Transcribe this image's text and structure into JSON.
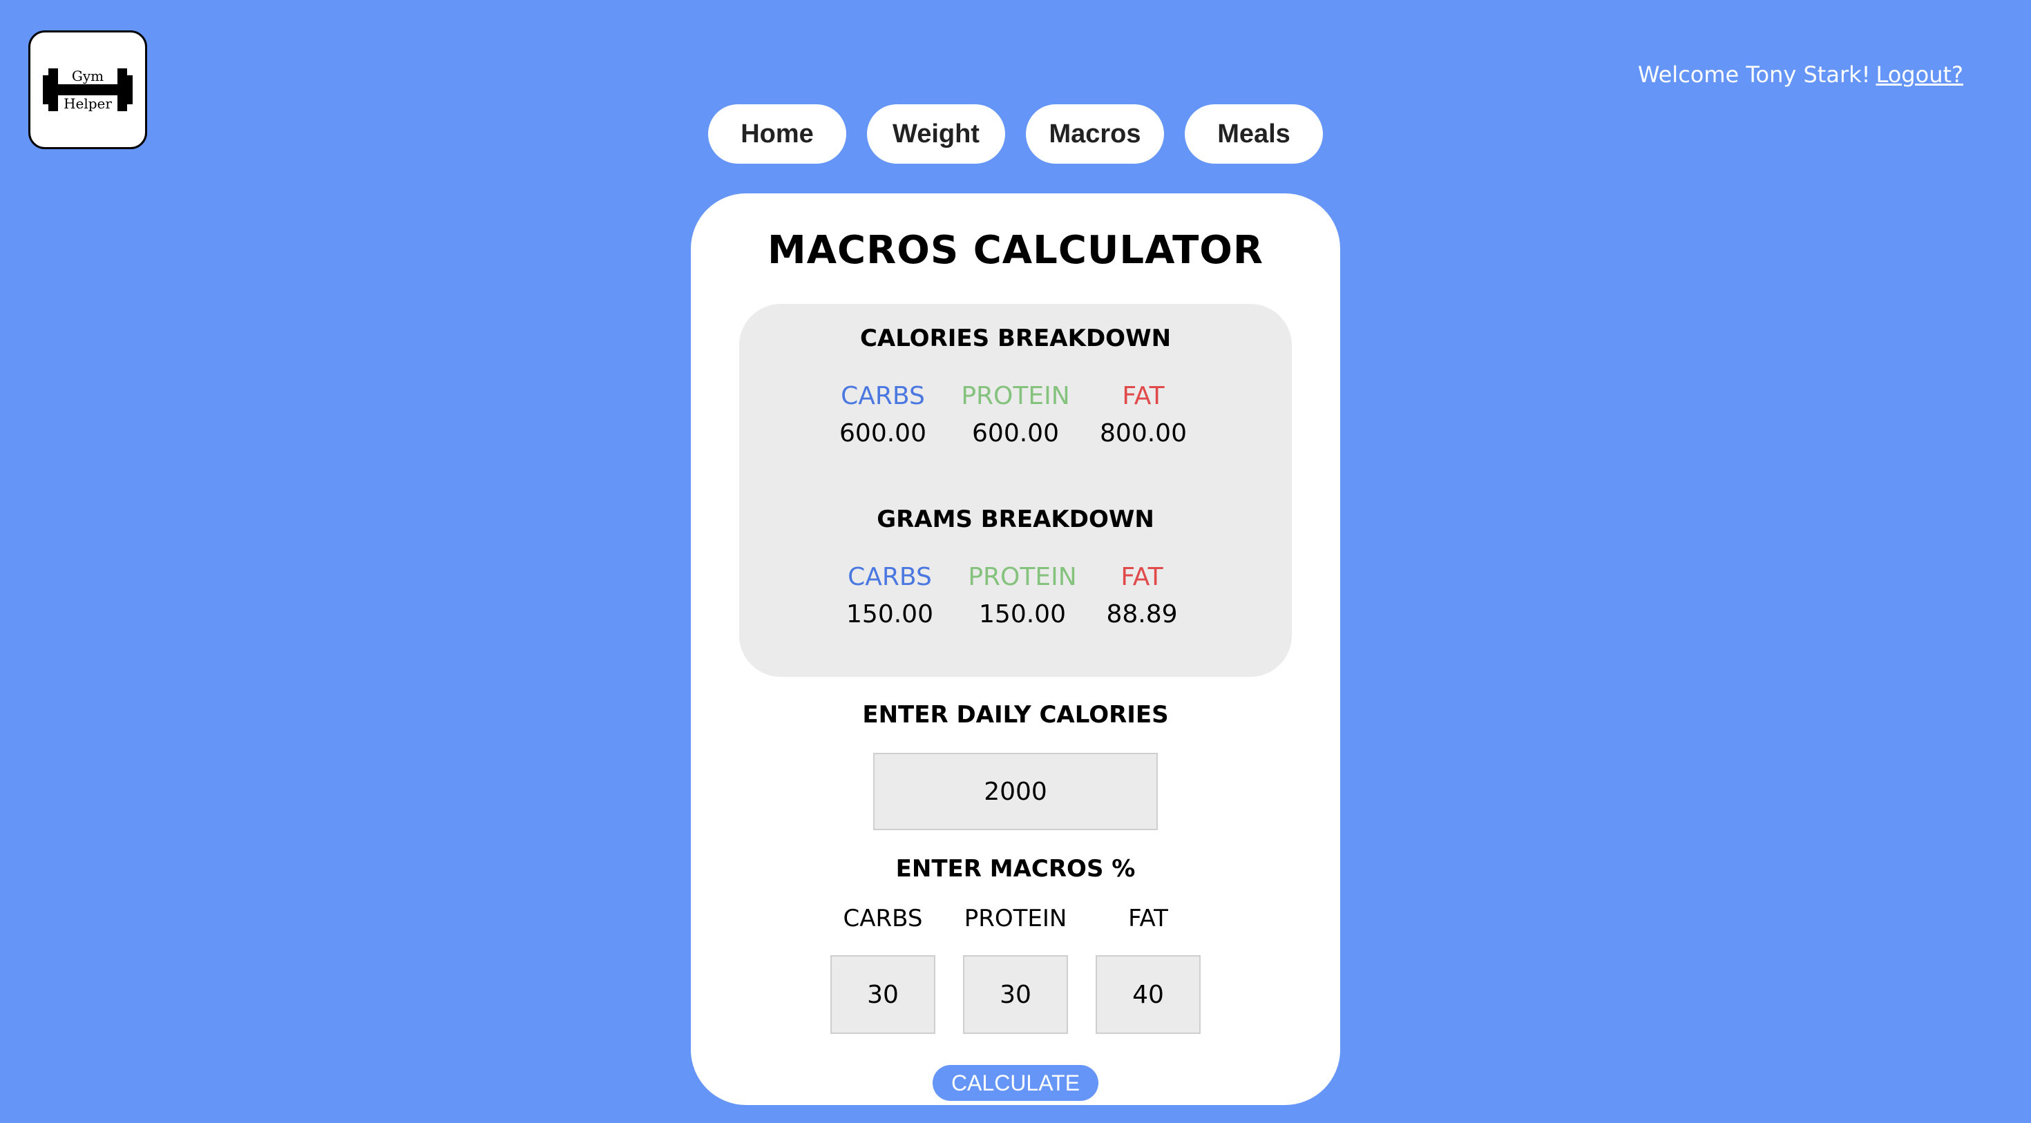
{
  "logo": {
    "line1": "Gym",
    "line2": "Helper",
    "icon": "dumbbell-icon"
  },
  "header": {
    "welcome_text": "Welcome Tony Stark!",
    "logout_label": "Logout?"
  },
  "nav": {
    "items": [
      {
        "label": "Home"
      },
      {
        "label": "Weight"
      },
      {
        "label": "Macros"
      },
      {
        "label": "Meals"
      }
    ]
  },
  "main": {
    "title": "MACROS CALCULATOR",
    "calories_breakdown": {
      "heading": "CALORIES BREAKDOWN",
      "carbs_label": "CARBS",
      "protein_label": "PROTEIN",
      "fat_label": "FAT",
      "carbs": "600.00",
      "protein": "600.00",
      "fat": "800.00"
    },
    "grams_breakdown": {
      "heading": "GRAMS BREAKDOWN",
      "carbs_label": "CARBS",
      "protein_label": "PROTEIN",
      "fat_label": "FAT",
      "carbs": "150.00",
      "protein": "150.00",
      "fat": "88.89"
    },
    "daily": {
      "heading": "ENTER DAILY CALORIES",
      "value": "2000"
    },
    "macros_pct": {
      "heading": "ENTER MACROS %",
      "carbs_label": "CARBS",
      "protein_label": "PROTEIN",
      "fat_label": "FAT",
      "carbs": "30",
      "protein": "30",
      "fat": "40"
    },
    "calculate_label": "CALCULATE"
  },
  "colors": {
    "background": "#6495f7",
    "carbs": "#4a78e0",
    "protein": "#84c27d",
    "fat": "#e04a4a"
  }
}
